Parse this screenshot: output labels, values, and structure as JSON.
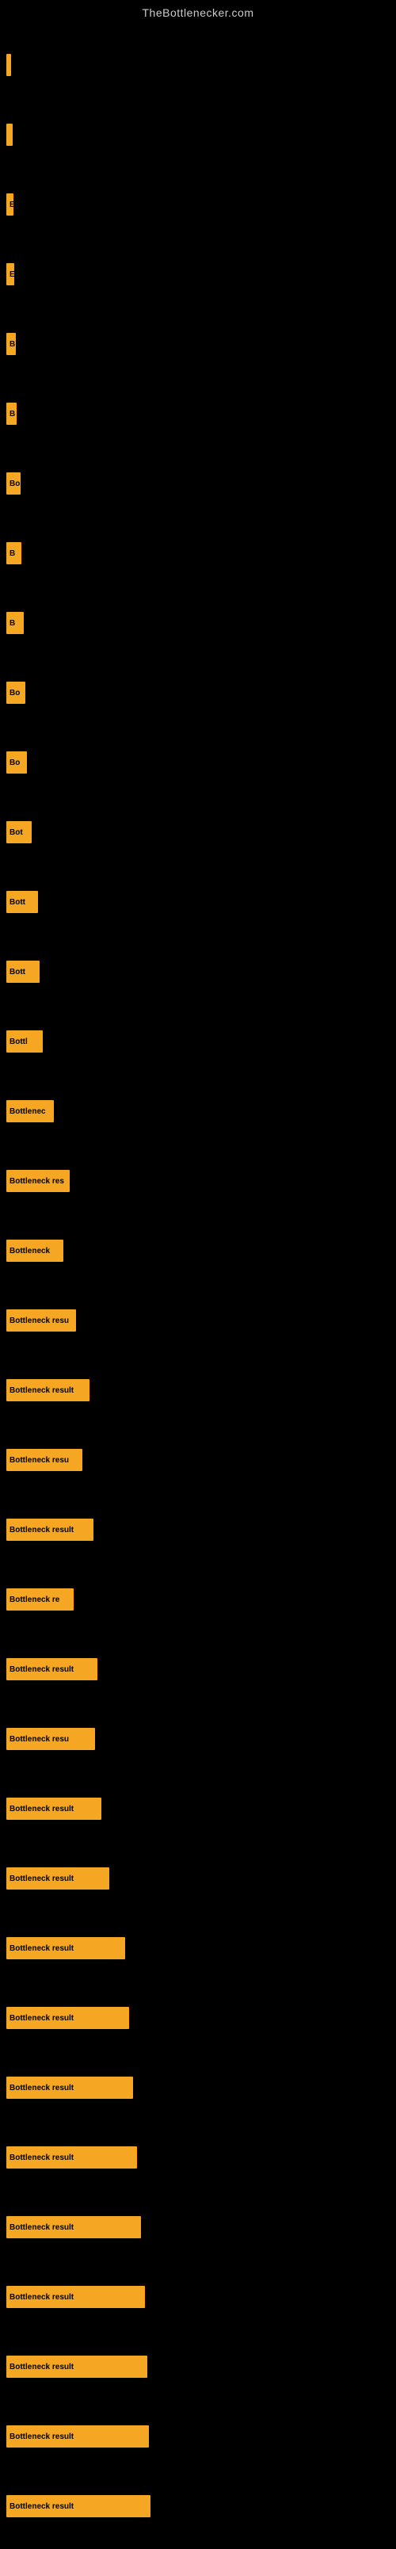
{
  "siteTitle": "TheBottlenecker.com",
  "bars": [
    {
      "id": 1,
      "width": 6,
      "label": ""
    },
    {
      "id": 2,
      "width": 8,
      "label": ""
    },
    {
      "id": 3,
      "width": 9,
      "label": "E"
    },
    {
      "id": 4,
      "width": 10,
      "label": "E"
    },
    {
      "id": 5,
      "width": 12,
      "label": "B"
    },
    {
      "id": 6,
      "width": 13,
      "label": "B"
    },
    {
      "id": 7,
      "width": 18,
      "label": "Bo"
    },
    {
      "id": 8,
      "width": 19,
      "label": "B"
    },
    {
      "id": 9,
      "width": 22,
      "label": "B"
    },
    {
      "id": 10,
      "width": 24,
      "label": "Bo"
    },
    {
      "id": 11,
      "width": 26,
      "label": "Bo"
    },
    {
      "id": 12,
      "width": 32,
      "label": "Bot"
    },
    {
      "id": 13,
      "width": 40,
      "label": "Bott"
    },
    {
      "id": 14,
      "width": 42,
      "label": "Bott"
    },
    {
      "id": 15,
      "width": 46,
      "label": "Bottl"
    },
    {
      "id": 16,
      "width": 60,
      "label": "Bottlenec"
    },
    {
      "id": 17,
      "width": 80,
      "label": "Bottleneck res"
    },
    {
      "id": 18,
      "width": 72,
      "label": "Bottleneck"
    },
    {
      "id": 19,
      "width": 88,
      "label": "Bottleneck resu"
    },
    {
      "id": 20,
      "width": 105,
      "label": "Bottleneck result"
    },
    {
      "id": 21,
      "width": 96,
      "label": "Bottleneck resu"
    },
    {
      "id": 22,
      "width": 110,
      "label": "Bottleneck result"
    },
    {
      "id": 23,
      "width": 85,
      "label": "Bottleneck re"
    },
    {
      "id": 24,
      "width": 115,
      "label": "Bottleneck result"
    },
    {
      "id": 25,
      "width": 112,
      "label": "Bottleneck resu"
    },
    {
      "id": 26,
      "width": 120,
      "label": "Bottleneck result"
    },
    {
      "id": 27,
      "width": 130,
      "label": "Bottleneck result"
    },
    {
      "id": 28,
      "width": 150,
      "label": "Bottleneck result"
    },
    {
      "id": 29,
      "width": 155,
      "label": "Bottleneck result"
    },
    {
      "id": 30,
      "width": 160,
      "label": "Bottleneck result"
    },
    {
      "id": 31,
      "width": 165,
      "label": "Bottleneck result"
    },
    {
      "id": 32,
      "width": 170,
      "label": "Bottleneck result"
    },
    {
      "id": 33,
      "width": 175,
      "label": "Bottleneck result"
    },
    {
      "id": 34,
      "width": 178,
      "label": "Bottleneck result"
    },
    {
      "id": 35,
      "width": 180,
      "label": "Bottleneck result"
    },
    {
      "id": 36,
      "width": 182,
      "label": "Bottleneck result"
    }
  ]
}
